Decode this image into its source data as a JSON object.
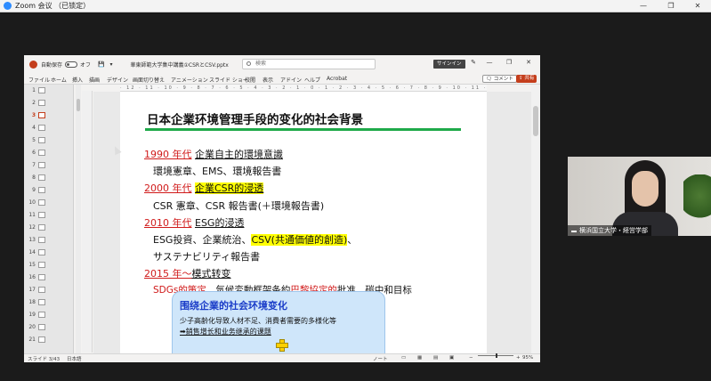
{
  "zoom": {
    "title": "Zoom 会议 （已锁定）",
    "min": "—",
    "max": "❐",
    "close": "✕"
  },
  "ppt": {
    "autosave_label": "自動保存",
    "autosave_state": "オフ",
    "filename": "華東師範大学集中講義①CSRとCSV.pptx",
    "search_placeholder": "検索",
    "signin": "サインイン",
    "ribbon_tabs": [
      "ファイル",
      "ホーム",
      "挿入",
      "描画",
      "デザイン",
      "画面切り替え",
      "アニメーション",
      "スライド ショー",
      "校閲",
      "表示",
      "アドイン",
      "ヘルプ",
      "Acrobat"
    ],
    "comment_btn": "コメント",
    "share_btn": "共有",
    "slide_numbers": [
      "1",
      "2",
      "3",
      "4",
      "5",
      "6",
      "7",
      "8",
      "9",
      "10",
      "11",
      "12",
      "13",
      "14",
      "15",
      "16",
      "17",
      "18",
      "19",
      "20",
      "21"
    ],
    "active_slide": "3",
    "ruler": "· 12 · 11 · 10 · 9 · 8 · 7 · 6 · 5 · 4 · 3 · 2 · 1 · 0 · 1 · 2 · 3 · 4 · 5 · 6 · 7 · 8 · 9 · 10 · 11 · 12 ·",
    "status_slide": "スライド 3/43",
    "status_lang": "日本語",
    "status_notes": "ノート",
    "status_zoom": "95%"
  },
  "slide": {
    "title": "日本企業环境管理手段的变化的社会背景",
    "l1_year": "1990 年代",
    "l1_text": "企業自主的環境意識",
    "l2": "環境憲章、EMS、環境報告書",
    "l3_year": "2000 年代",
    "l3_text": "企業CSR的浸透",
    "l4": "CSR 憲章、CSR 報告書(＋環境報告書)",
    "l5_year": "2010 年代",
    "l5_text": "ESG的浸透",
    "l6_a": "ESG投資、企業統治、",
    "l6_b": "CSV(共通価値的創造)",
    "l6_c": "、",
    "l7": "サステナビリティ報告書",
    "l8_year": "2015 年～",
    "l8_text": "模式转变",
    "l9_a": "SDGs的策定",
    "l9_b": "、気候変動框架条約",
    "l9_c": "巴黎協定的",
    "l9_d": "批准，碳中和目标",
    "callout_title": "围绕企業的社会环境变化",
    "callout_l1": "少子高齢化导致人材不足、消費者需要的多様化等",
    "callout_l2": "➡銷售增长和业务继承的课题"
  },
  "video": {
    "participant": "横浜国立大学・経営学部"
  }
}
